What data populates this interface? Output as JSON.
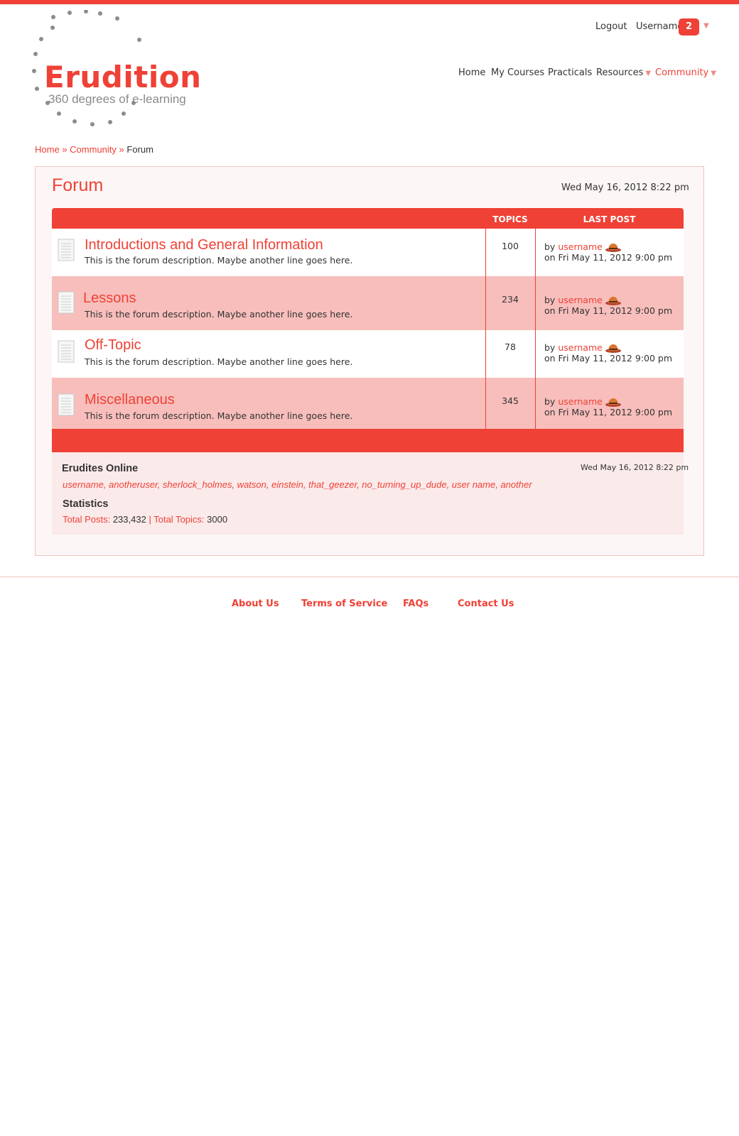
{
  "brand": {
    "name": "Erudition",
    "tagline": "360 degrees of e-learning"
  },
  "user_menu": {
    "logout": "Logout",
    "username": "Username",
    "notification_count": "2"
  },
  "nav": {
    "home": "Home",
    "my_courses": "My Courses",
    "practicals": "Practicals",
    "resources": "Resources",
    "community": "Community"
  },
  "breadcrumb": {
    "home": "Home",
    "sep1": "»",
    "community": "Community",
    "sep2": "»",
    "current": "Forum"
  },
  "page": {
    "title": "Forum",
    "date": "Wed May 16, 2012 8:22 pm"
  },
  "table": {
    "col_topics": "TOPICS",
    "col_last_post": "LAST POST",
    "rows": [
      {
        "title": "Introductions and General Information",
        "description": "This is the forum description. Maybe another line goes here.",
        "topics": "100",
        "by": "by",
        "user": "username",
        "date": "on Fri May 11, 2012 9:00 pm"
      },
      {
        "title": "Lessons",
        "description": "This is the forum description. Maybe another line goes here.",
        "topics": "234",
        "by": "by",
        "user": "username",
        "date": "on Fri May 11, 2012 9:00 pm"
      },
      {
        "title": "Off-Topic",
        "description": "This is the forum description. Maybe another line goes here.",
        "topics": "78",
        "by": "by",
        "user": "username",
        "date": "on Fri May 11, 2012 9:00 pm"
      },
      {
        "title": "Miscellaneous",
        "description": "This is the forum description. Maybe another line goes here.",
        "topics": "345",
        "by": "by",
        "user": "username",
        "date": "on Fri May 11, 2012 9:00 pm"
      }
    ]
  },
  "online": {
    "heading": "Erudites Online",
    "date": "Wed May 16, 2012 8:22 pm",
    "users": "username, anotheruser, sherlock_holmes, watson, einstein, that_geezer, no_turning_up_dude, user name, another"
  },
  "statistics": {
    "heading": "Statistics",
    "posts_label": "Total Posts:",
    "posts_value": "233,432",
    "sep": "|",
    "topics_label": "Total Topics:",
    "topics_value": "3000"
  },
  "footer": {
    "about": "About Us",
    "terms": "Terms of Service",
    "faqs": "FAQs",
    "contact": "Contact Us"
  },
  "colors": {
    "accent": "#ef4136",
    "row_alt": "#f7bebb",
    "panel_bg": "#fdf6f6",
    "info_bg": "#fbeaea"
  },
  "icons": {
    "forum_row": "document-icon",
    "last_post_badge": "hat-icon",
    "dropdown": "caret-down-icon"
  }
}
